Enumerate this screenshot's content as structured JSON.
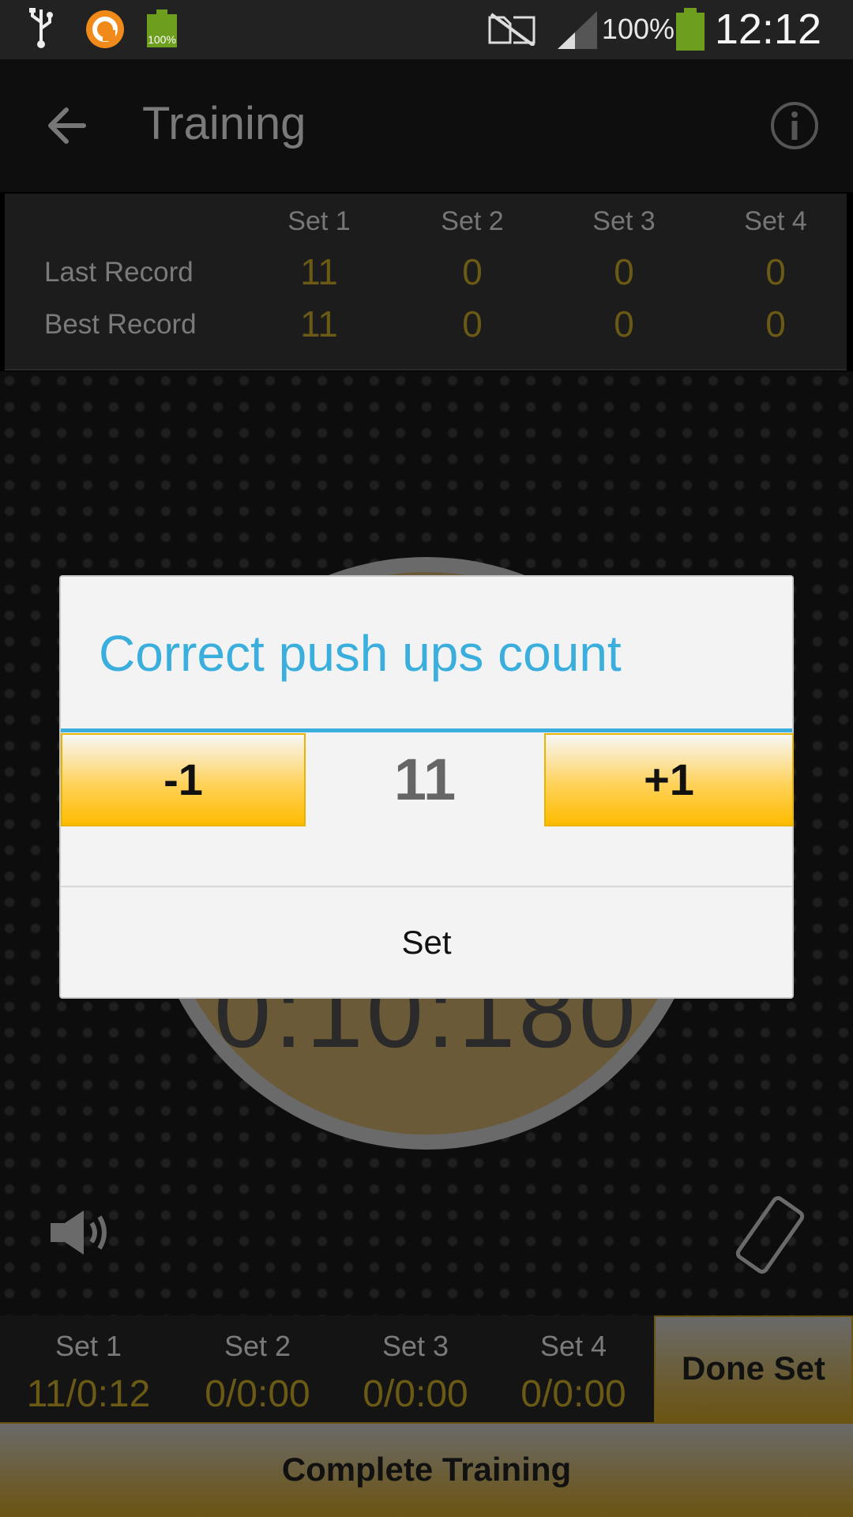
{
  "status_bar": {
    "battery_percent": "100%",
    "battery_icon_percent": "100%",
    "time": "12:12"
  },
  "action_bar": {
    "title": "Training"
  },
  "records": {
    "headers": [
      "Set 1",
      "Set 2",
      "Set 3",
      "Set 4"
    ],
    "rows": [
      {
        "label": "Last Record",
        "values": [
          "11",
          "0",
          "0",
          "0"
        ]
      },
      {
        "label": "Best Record",
        "values": [
          "11",
          "0",
          "0",
          "0"
        ]
      }
    ]
  },
  "timer": {
    "value": "0:10:180"
  },
  "sets_bar": {
    "sets": [
      {
        "label": "Set 1",
        "value": "11/0:12"
      },
      {
        "label": "Set 2",
        "value": "0/0:00"
      },
      {
        "label": "Set 3",
        "value": "0/0:00"
      },
      {
        "label": "Set 4",
        "value": "0/0:00"
      }
    ],
    "done_set_label": "Done Set"
  },
  "complete_training_label": "Complete Training",
  "dialog": {
    "title": "Correct push ups count",
    "minus_label": "-1",
    "count": "11",
    "plus_label": "+1",
    "set_label": "Set"
  },
  "colors": {
    "accent": "#3aaedc",
    "button_yellow": "#ffbb00",
    "record_gold": "#6b5a16"
  }
}
